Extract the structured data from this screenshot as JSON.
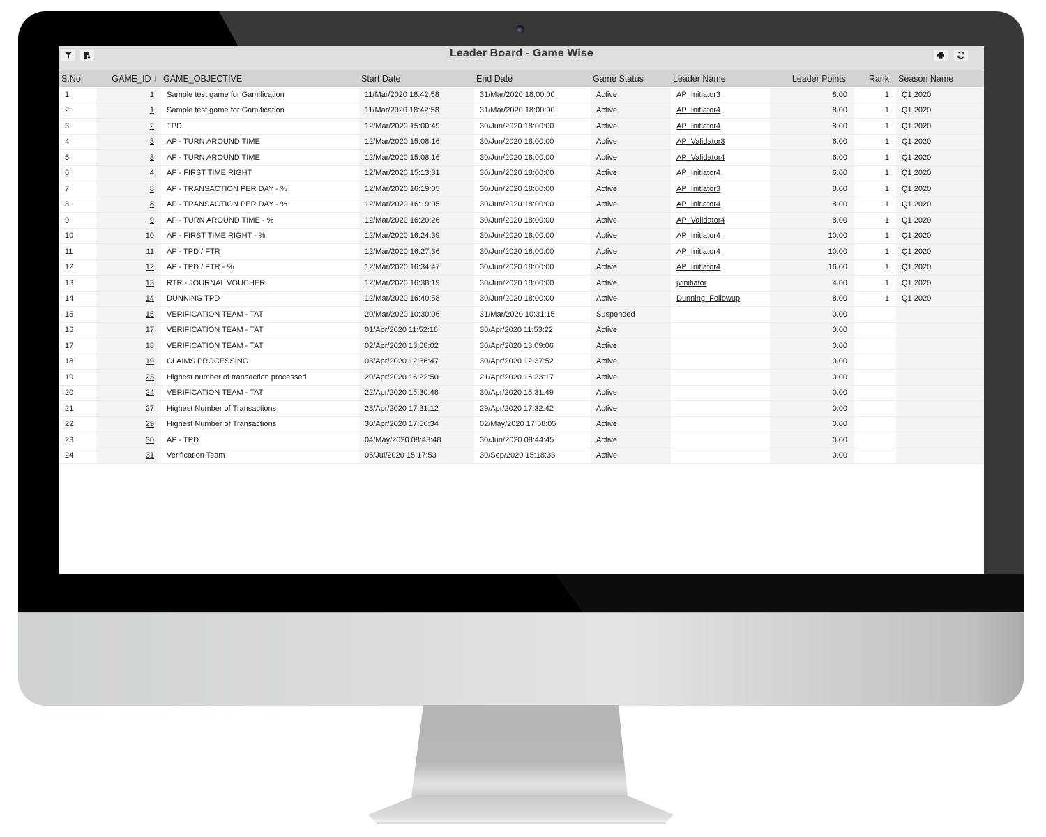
{
  "app": {
    "title": "Leader Board - Game Wise"
  },
  "toolbar": {
    "left_buttons": [
      {
        "icon": "filter-icon",
        "label": "Filter"
      },
      {
        "icon": "export-icon",
        "label": "Export"
      }
    ],
    "right_buttons": [
      {
        "icon": "print-icon",
        "label": "Print"
      },
      {
        "icon": "refresh-icon",
        "label": "Refresh"
      }
    ]
  },
  "table": {
    "sort": {
      "column": "GAME_ID",
      "direction": "descending",
      "indicator_color": "#dd3333"
    },
    "columns": [
      "S.No.",
      "GAME_ID",
      "GAME_OBJECTIVE",
      "Start Date",
      "End Date",
      "Game Status",
      "Leader Name",
      "Leader Points",
      "Rank",
      "Season Name"
    ],
    "rows": [
      {
        "sno": "1",
        "game_id": "1",
        "objective": "Sample test game for Gamification",
        "start": "11/Mar/2020 18:42:58",
        "end": "31/Mar/2020 18:00:00",
        "status": "Active",
        "leader": "AP_Initiator3",
        "points": "8.00",
        "rank": "1",
        "season": "Q1 2020"
      },
      {
        "sno": "2",
        "game_id": "1",
        "objective": "Sample test game for Gamification",
        "start": "11/Mar/2020 18:42:58",
        "end": "31/Mar/2020 18:00:00",
        "status": "Active",
        "leader": "AP_Initiator4",
        "points": "8.00",
        "rank": "1",
        "season": "Q1 2020"
      },
      {
        "sno": "3",
        "game_id": "2",
        "objective": "TPD",
        "start": "12/Mar/2020 15:00:49",
        "end": "30/Jun/2020 18:00:00",
        "status": "Active",
        "leader": "AP_Initiator4",
        "points": "8.00",
        "rank": "1",
        "season": "Q1 2020"
      },
      {
        "sno": "4",
        "game_id": "3",
        "objective": "AP - TURN AROUND TIME",
        "start": "12/Mar/2020 15:08:16",
        "end": "30/Jun/2020 18:00:00",
        "status": "Active",
        "leader": "AP_Validator3",
        "points": "6.00",
        "rank": "1",
        "season": "Q1 2020"
      },
      {
        "sno": "5",
        "game_id": "3",
        "objective": "AP - TURN AROUND TIME",
        "start": "12/Mar/2020 15:08:16",
        "end": "30/Jun/2020 18:00:00",
        "status": "Active",
        "leader": "AP_Validator4",
        "points": "6.00",
        "rank": "1",
        "season": "Q1 2020"
      },
      {
        "sno": "6",
        "game_id": "4",
        "objective": "AP - FIRST TIME RIGHT",
        "start": "12/Mar/2020 15:13:31",
        "end": "30/Jun/2020 18:00:00",
        "status": "Active",
        "leader": "AP_Initiator4",
        "points": "6.00",
        "rank": "1",
        "season": "Q1 2020"
      },
      {
        "sno": "7",
        "game_id": "8",
        "objective": "AP - TRANSACTION PER DAY - %",
        "start": "12/Mar/2020 16:19:05",
        "end": "30/Jun/2020 18:00:00",
        "status": "Active",
        "leader": "AP_Initiator3",
        "points": "8.00",
        "rank": "1",
        "season": "Q1 2020"
      },
      {
        "sno": "8",
        "game_id": "8",
        "objective": "AP - TRANSACTION PER DAY - %",
        "start": "12/Mar/2020 16:19:05",
        "end": "30/Jun/2020 18:00:00",
        "status": "Active",
        "leader": "AP_Initiator4",
        "points": "8.00",
        "rank": "1",
        "season": "Q1 2020"
      },
      {
        "sno": "9",
        "game_id": "9",
        "objective": "AP - TURN AROUND TIME - %",
        "start": "12/Mar/2020 16:20:26",
        "end": "30/Jun/2020 18:00:00",
        "status": "Active",
        "leader": "AP_Validator4",
        "points": "8.00",
        "rank": "1",
        "season": "Q1 2020"
      },
      {
        "sno": "10",
        "game_id": "10",
        "objective": "AP - FIRST TIME RIGHT - %",
        "start": "12/Mar/2020 16:24:39",
        "end": "30/Jun/2020 18:00:00",
        "status": "Active",
        "leader": "AP_Initiator4",
        "points": "10.00",
        "rank": "1",
        "season": "Q1 2020"
      },
      {
        "sno": "11",
        "game_id": "11",
        "objective": "AP - TPD / FTR",
        "start": "12/Mar/2020 16:27:36",
        "end": "30/Jun/2020 18:00:00",
        "status": "Active",
        "leader": "AP_Initiator4",
        "points": "10.00",
        "rank": "1",
        "season": "Q1 2020"
      },
      {
        "sno": "12",
        "game_id": "12",
        "objective": "AP - TPD / FTR - %",
        "start": "12/Mar/2020 16:34:47",
        "end": "30/Jun/2020 18:00:00",
        "status": "Active",
        "leader": "AP_Initiator4",
        "points": "16.00",
        "rank": "1",
        "season": "Q1 2020"
      },
      {
        "sno": "13",
        "game_id": "13",
        "objective": "RTR - JOURNAL VOUCHER",
        "start": "12/Mar/2020 16:38:19",
        "end": "30/Jun/2020 18:00:00",
        "status": "Active",
        "leader": "jvinitiator",
        "points": "4.00",
        "rank": "1",
        "season": "Q1 2020"
      },
      {
        "sno": "14",
        "game_id": "14",
        "objective": "DUNNING TPD",
        "start": "12/Mar/2020 16:40:58",
        "end": "30/Jun/2020 18:00:00",
        "status": "Active",
        "leader": "Dunning_Followup",
        "points": "8.00",
        "rank": "1",
        "season": "Q1 2020"
      },
      {
        "sno": "15",
        "game_id": "15",
        "objective": "VERIFICATION TEAM - TAT",
        "start": "20/Mar/2020 10:30:06",
        "end": "31/Mar/2020 10:31:15",
        "status": "Suspended",
        "leader": "",
        "points": "0.00",
        "rank": "",
        "season": ""
      },
      {
        "sno": "16",
        "game_id": "17",
        "objective": "VERIFICATION TEAM - TAT",
        "start": "01/Apr/2020 11:52:16",
        "end": "30/Apr/2020 11:53:22",
        "status": "Active",
        "leader": "",
        "points": "0.00",
        "rank": "",
        "season": ""
      },
      {
        "sno": "17",
        "game_id": "18",
        "objective": "VERIFICATION TEAM - TAT",
        "start": "02/Apr/2020 13:08:02",
        "end": "30/Apr/2020 13:09:06",
        "status": "Active",
        "leader": "",
        "points": "0.00",
        "rank": "",
        "season": ""
      },
      {
        "sno": "18",
        "game_id": "19",
        "objective": "CLAIMS PROCESSING",
        "start": "03/Apr/2020 12:36:47",
        "end": "30/Apr/2020 12:37:52",
        "status": "Active",
        "leader": "",
        "points": "0.00",
        "rank": "",
        "season": ""
      },
      {
        "sno": "19",
        "game_id": "23",
        "objective": "Highest number of transaction processed",
        "start": "20/Apr/2020 16:22:50",
        "end": "21/Apr/2020 16:23:17",
        "status": "Active",
        "leader": "",
        "points": "0.00",
        "rank": "",
        "season": ""
      },
      {
        "sno": "20",
        "game_id": "24",
        "objective": "VERIFICATION TEAM - TAT",
        "start": "22/Apr/2020 15:30:48",
        "end": "30/Apr/2020 15:31:49",
        "status": "Active",
        "leader": "",
        "points": "0.00",
        "rank": "",
        "season": ""
      },
      {
        "sno": "21",
        "game_id": "27",
        "objective": "Highest Number of Transactions",
        "start": "28/Apr/2020 17:31:12",
        "end": "29/Apr/2020 17:32:42",
        "status": "Active",
        "leader": "",
        "points": "0.00",
        "rank": "",
        "season": ""
      },
      {
        "sno": "22",
        "game_id": "29",
        "objective": "Highest Number of Transactions",
        "start": "30/Apr/2020 17:56:34",
        "end": "02/May/2020 17:58:05",
        "status": "Active",
        "leader": "",
        "points": "0.00",
        "rank": "",
        "season": ""
      },
      {
        "sno": "23",
        "game_id": "30",
        "objective": "AP - TPD",
        "start": "04/May/2020 08:43:48",
        "end": "30/Jun/2020 08:44:45",
        "status": "Active",
        "leader": "",
        "points": "0.00",
        "rank": "",
        "season": ""
      },
      {
        "sno": "24",
        "game_id": "31",
        "objective": "Verification Team",
        "start": "06/Jul/2020 15:17:53",
        "end": "30/Sep/2020 15:18:33",
        "status": "Active",
        "leader": "",
        "points": "0.00",
        "rank": "",
        "season": ""
      }
    ]
  },
  "colors": {
    "toolbar_bg": "#dedede",
    "header_bg": "#d3d3d3",
    "shaded_column_bg": "#f4f4f4",
    "sort_indicator": "#dd3333"
  }
}
